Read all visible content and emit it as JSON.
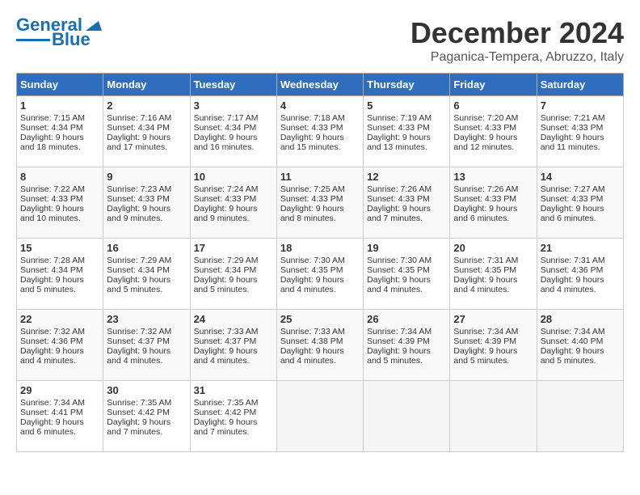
{
  "header": {
    "logo_line1": "General",
    "logo_line2": "Blue",
    "month": "December 2024",
    "location": "Paganica-Tempera, Abruzzo, Italy"
  },
  "weekdays": [
    "Sunday",
    "Monday",
    "Tuesday",
    "Wednesday",
    "Thursday",
    "Friday",
    "Saturday"
  ],
  "weeks": [
    [
      {
        "day": "1",
        "sunrise": "7:15 AM",
        "sunset": "4:34 PM",
        "daylight": "9 hours and 18 minutes."
      },
      {
        "day": "2",
        "sunrise": "7:16 AM",
        "sunset": "4:34 PM",
        "daylight": "9 hours and 17 minutes."
      },
      {
        "day": "3",
        "sunrise": "7:17 AM",
        "sunset": "4:34 PM",
        "daylight": "9 hours and 16 minutes."
      },
      {
        "day": "4",
        "sunrise": "7:18 AM",
        "sunset": "4:33 PM",
        "daylight": "9 hours and 15 minutes."
      },
      {
        "day": "5",
        "sunrise": "7:19 AM",
        "sunset": "4:33 PM",
        "daylight": "9 hours and 13 minutes."
      },
      {
        "day": "6",
        "sunrise": "7:20 AM",
        "sunset": "4:33 PM",
        "daylight": "9 hours and 12 minutes."
      },
      {
        "day": "7",
        "sunrise": "7:21 AM",
        "sunset": "4:33 PM",
        "daylight": "9 hours and 11 minutes."
      }
    ],
    [
      {
        "day": "8",
        "sunrise": "7:22 AM",
        "sunset": "4:33 PM",
        "daylight": "9 hours and 10 minutes."
      },
      {
        "day": "9",
        "sunrise": "7:23 AM",
        "sunset": "4:33 PM",
        "daylight": "9 hours and 9 minutes."
      },
      {
        "day": "10",
        "sunrise": "7:24 AM",
        "sunset": "4:33 PM",
        "daylight": "9 hours and 9 minutes."
      },
      {
        "day": "11",
        "sunrise": "7:25 AM",
        "sunset": "4:33 PM",
        "daylight": "9 hours and 8 minutes."
      },
      {
        "day": "12",
        "sunrise": "7:26 AM",
        "sunset": "4:33 PM",
        "daylight": "9 hours and 7 minutes."
      },
      {
        "day": "13",
        "sunrise": "7:26 AM",
        "sunset": "4:33 PM",
        "daylight": "9 hours and 6 minutes."
      },
      {
        "day": "14",
        "sunrise": "7:27 AM",
        "sunset": "4:33 PM",
        "daylight": "9 hours and 6 minutes."
      }
    ],
    [
      {
        "day": "15",
        "sunrise": "7:28 AM",
        "sunset": "4:34 PM",
        "daylight": "9 hours and 5 minutes."
      },
      {
        "day": "16",
        "sunrise": "7:29 AM",
        "sunset": "4:34 PM",
        "daylight": "9 hours and 5 minutes."
      },
      {
        "day": "17",
        "sunrise": "7:29 AM",
        "sunset": "4:34 PM",
        "daylight": "9 hours and 5 minutes."
      },
      {
        "day": "18",
        "sunrise": "7:30 AM",
        "sunset": "4:35 PM",
        "daylight": "9 hours and 4 minutes."
      },
      {
        "day": "19",
        "sunrise": "7:30 AM",
        "sunset": "4:35 PM",
        "daylight": "9 hours and 4 minutes."
      },
      {
        "day": "20",
        "sunrise": "7:31 AM",
        "sunset": "4:35 PM",
        "daylight": "9 hours and 4 minutes."
      },
      {
        "day": "21",
        "sunrise": "7:31 AM",
        "sunset": "4:36 PM",
        "daylight": "9 hours and 4 minutes."
      }
    ],
    [
      {
        "day": "22",
        "sunrise": "7:32 AM",
        "sunset": "4:36 PM",
        "daylight": "9 hours and 4 minutes."
      },
      {
        "day": "23",
        "sunrise": "7:32 AM",
        "sunset": "4:37 PM",
        "daylight": "9 hours and 4 minutes."
      },
      {
        "day": "24",
        "sunrise": "7:33 AM",
        "sunset": "4:37 PM",
        "daylight": "9 hours and 4 minutes."
      },
      {
        "day": "25",
        "sunrise": "7:33 AM",
        "sunset": "4:38 PM",
        "daylight": "9 hours and 4 minutes."
      },
      {
        "day": "26",
        "sunrise": "7:34 AM",
        "sunset": "4:39 PM",
        "daylight": "9 hours and 5 minutes."
      },
      {
        "day": "27",
        "sunrise": "7:34 AM",
        "sunset": "4:39 PM",
        "daylight": "9 hours and 5 minutes."
      },
      {
        "day": "28",
        "sunrise": "7:34 AM",
        "sunset": "4:40 PM",
        "daylight": "9 hours and 5 minutes."
      }
    ],
    [
      {
        "day": "29",
        "sunrise": "7:34 AM",
        "sunset": "4:41 PM",
        "daylight": "9 hours and 6 minutes."
      },
      {
        "day": "30",
        "sunrise": "7:35 AM",
        "sunset": "4:42 PM",
        "daylight": "9 hours and 7 minutes."
      },
      {
        "day": "31",
        "sunrise": "7:35 AM",
        "sunset": "4:42 PM",
        "daylight": "9 hours and 7 minutes."
      },
      null,
      null,
      null,
      null
    ]
  ]
}
